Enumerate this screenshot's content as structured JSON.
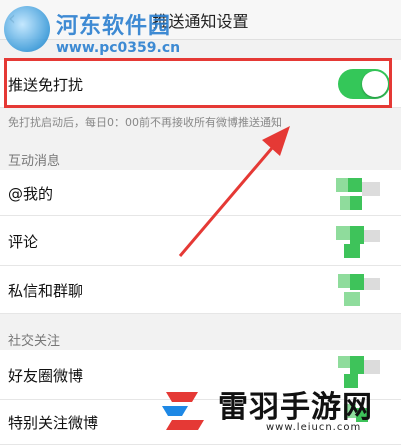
{
  "header": {
    "title": "推送通知设置",
    "back_icon": "back-arrow-icon"
  },
  "watermark_top": {
    "text": "河东软件园",
    "url": "www.pc0359.cn"
  },
  "dnd": {
    "label": "推送免打扰",
    "toggle_on": true,
    "description": "免打扰启动后，每日0：00前不再接收所有微博推送通知"
  },
  "sections": [
    {
      "title": "互动消息",
      "items": [
        {
          "label": "@我的"
        },
        {
          "label": "评论"
        },
        {
          "label": "私信和群聊"
        }
      ]
    },
    {
      "title": "社交关注",
      "items": [
        {
          "label": "好友圈微博"
        },
        {
          "label": "特别关注微博"
        }
      ]
    }
  ],
  "watermark_bottom": {
    "name": "雷羽手游网",
    "url": "www.leiucn.com"
  },
  "colors": {
    "toggle_on": "#34c759",
    "highlight": "#e53935",
    "accent": "#2a7fd0"
  }
}
